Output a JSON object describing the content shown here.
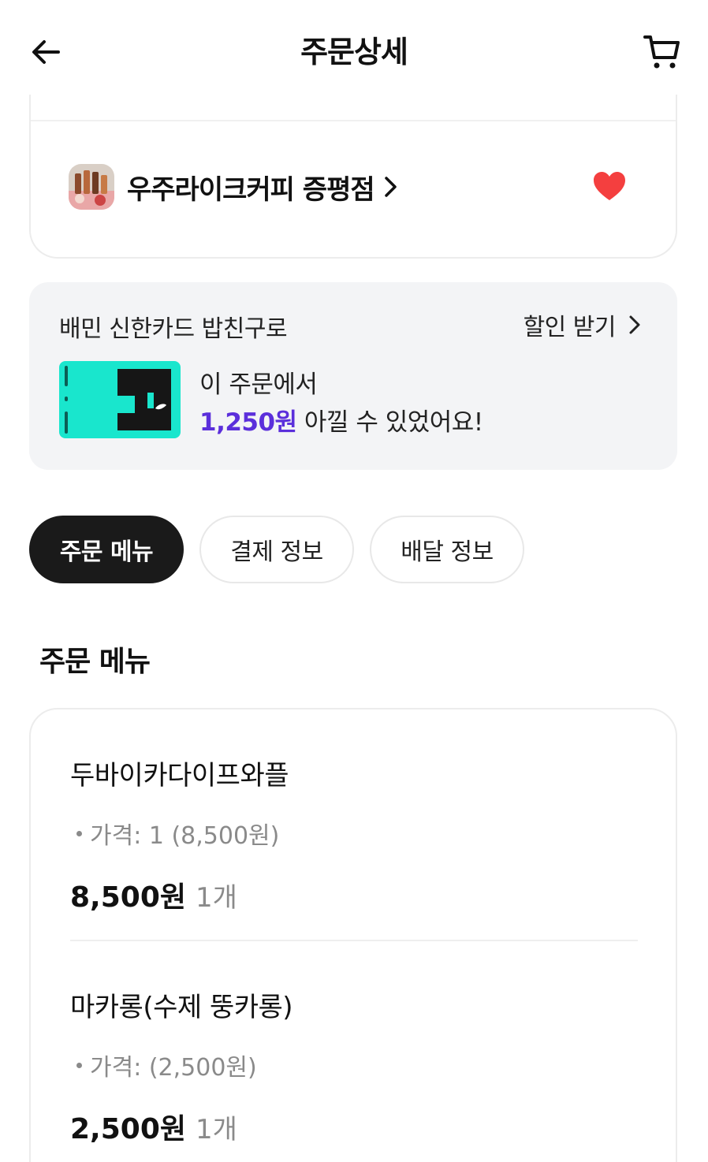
{
  "header": {
    "title": "주문상세",
    "back_icon": "arrow-left-icon",
    "cart_icon": "cart-icon"
  },
  "store": {
    "name": "우주라이크커피 증평점",
    "favorite": true,
    "heart_color": "#f43f3f"
  },
  "promo": {
    "title": "배민 신한카드 밥친구로",
    "link_label": "할인 받기",
    "line1": "이 주문에서",
    "amount": "1,250원",
    "line2_rest": " 아낄 수 있었어요!",
    "card_color": "#19e6cd",
    "amount_color": "#5b2fdb"
  },
  "tabs": [
    {
      "label": "주문 메뉴",
      "active": true
    },
    {
      "label": "결제 정보",
      "active": false
    },
    {
      "label": "배달 정보",
      "active": false
    }
  ],
  "section": {
    "title": "주문 메뉴"
  },
  "menu_items": [
    {
      "name": "두바이카다이프와플",
      "option": "가격: 1 (8,500원)",
      "price": "8,500원",
      "qty": "1개"
    },
    {
      "name": "마카롱(수제 뚱카롱)",
      "option": "가격: (2,500원)",
      "price": "2,500원",
      "qty": "1개"
    }
  ]
}
